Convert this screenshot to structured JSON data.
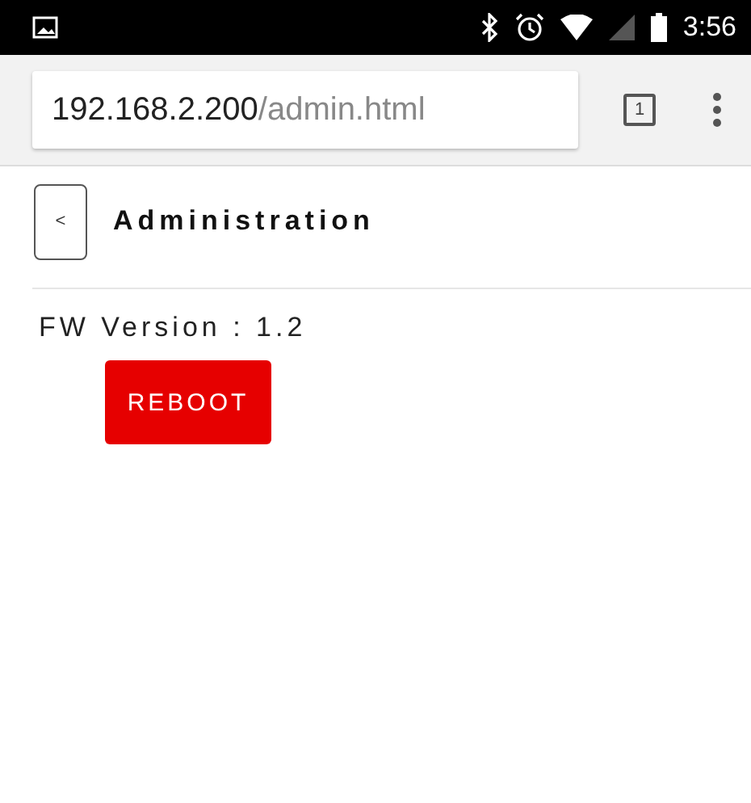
{
  "status_bar": {
    "time": "3:56"
  },
  "browser": {
    "url_host": "192.168.2.200",
    "url_path": "/admin.html",
    "tab_count": "1"
  },
  "header": {
    "back_label": "<",
    "title": "Administration"
  },
  "content": {
    "version_text": "FW Version : 1.2",
    "button": "REBOOT"
  }
}
